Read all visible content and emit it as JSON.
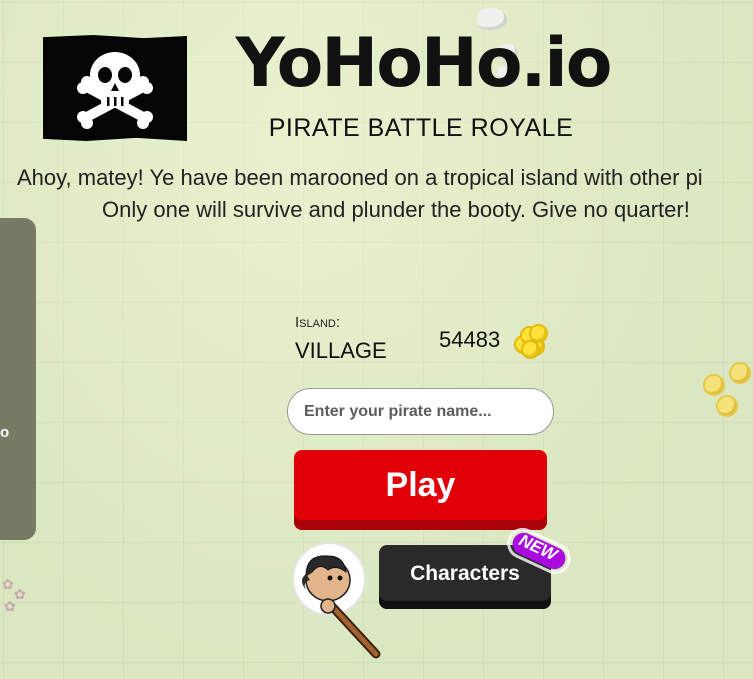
{
  "header": {
    "logo_title": "YoHoHo.io",
    "logo_subtitle": "PIRATE BATTLE ROYALE"
  },
  "intro": {
    "line1": "Ahoy, matey! Ye have been marooned on a tropical island with other pi",
    "line2": "Only one will survive and plunder the booty. Give no quarter!"
  },
  "side_panel": {
    "visible_text": "o"
  },
  "island": {
    "label": "Island:",
    "name": "VILLAGE"
  },
  "coins": {
    "count": "54483"
  },
  "name_input": {
    "placeholder": "Enter your pirate name...",
    "value": ""
  },
  "play_button": {
    "label": "Play"
  },
  "characters": {
    "button_label": "Characters",
    "badge": "NEW"
  },
  "colors": {
    "play_red": "#e20008",
    "characters_dark": "#2a2a2a",
    "new_badge_purple": "#a80ae0",
    "background": "#dde8c2"
  },
  "icons": [
    "skull-crossbones-flag-icon",
    "gold-coins-icon",
    "pirate-avatar-icon",
    "new-badge-icon"
  ]
}
